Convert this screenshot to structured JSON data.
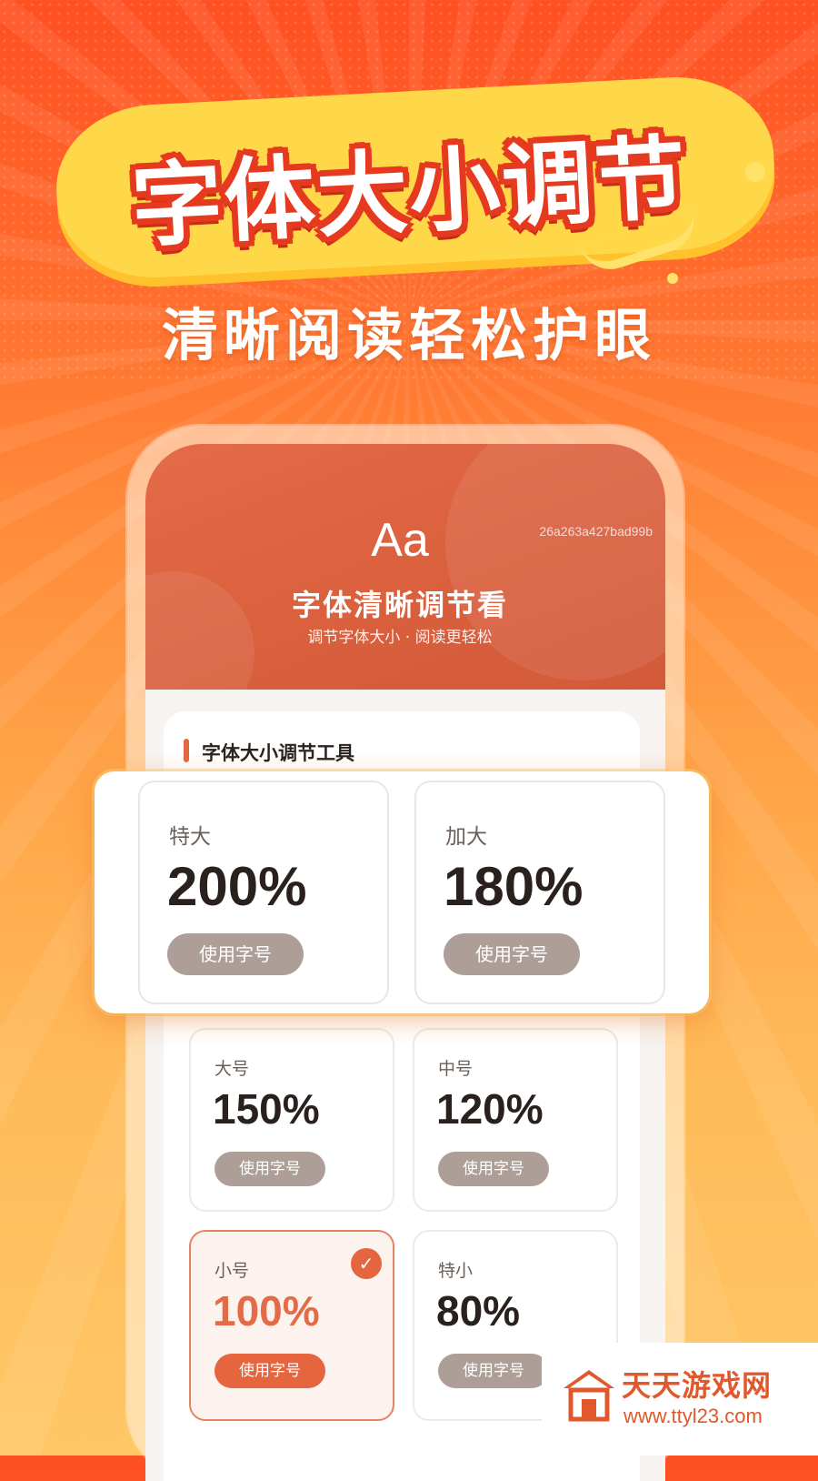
{
  "promo": {
    "headline": "字体大小调节",
    "subheadline": "清晰阅读轻松护眼"
  },
  "app": {
    "icon_text": "Aa",
    "hash": "26a263a427bad99b",
    "title": "字体清晰调节看",
    "subtitle": "调节字体大小 · 阅读更轻松",
    "section_title": "字体大小调节工具"
  },
  "featured_sizes": [
    {
      "label": "特大",
      "value": "200%",
      "button": "使用字号"
    },
    {
      "label": "加大",
      "value": "180%",
      "button": "使用字号"
    }
  ],
  "sizes": [
    {
      "label": "大号",
      "value": "150%",
      "button": "使用字号",
      "selected": false
    },
    {
      "label": "中号",
      "value": "120%",
      "button": "使用字号",
      "selected": false
    },
    {
      "label": "小号",
      "value": "100%",
      "button": "使用字号",
      "selected": true
    },
    {
      "label": "特小",
      "value": "80%",
      "button": "使用字号",
      "selected": false
    }
  ],
  "watermark": {
    "name": "天天游戏网",
    "url": "www.ttyl23.com"
  },
  "colors": {
    "accent": "#e4653e",
    "banner": "#ffd84a",
    "button_gray": "#ad9f97"
  },
  "icons": {
    "selected_badge": "check-icon",
    "watermark_logo": "house-logo-icon"
  }
}
